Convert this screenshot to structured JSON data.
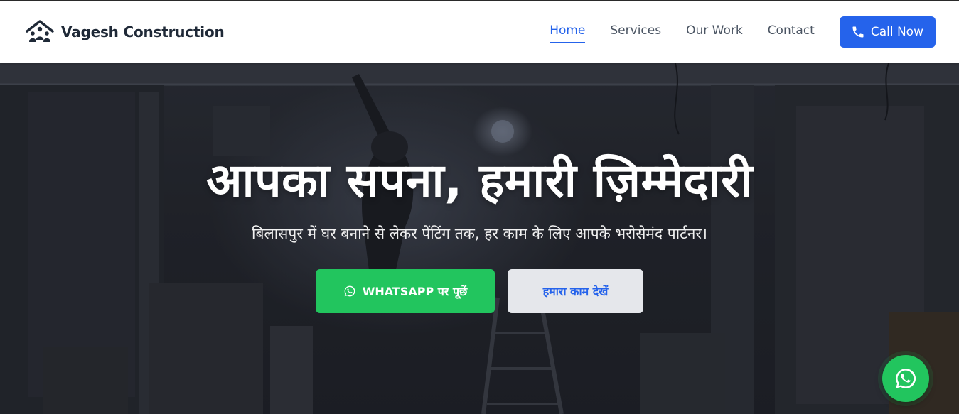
{
  "brand": {
    "name": "Vagesh Construction",
    "logo_icon": "house-with-family-icon"
  },
  "nav": {
    "links": [
      {
        "label": "Home",
        "active": true
      },
      {
        "label": "Services",
        "active": false
      },
      {
        "label": "Our Work",
        "active": false
      },
      {
        "label": "Contact",
        "active": false
      }
    ],
    "call_button": {
      "label": "Call Now",
      "icon": "phone-icon"
    }
  },
  "hero": {
    "title": "आपका सपना, हमारी ज़िम्मेदारी",
    "subtitle": "बिलासपुर में घर बनाने से लेकर पेंटिंग तक, हर काम के लिए आपके भरोसेमंद पार्टनर।",
    "whatsapp_button": {
      "label": "WHATSAPP पर पूछें",
      "icon": "whatsapp-icon"
    },
    "work_button": {
      "label": "हमारा काम देखें"
    }
  },
  "floating_whatsapp": {
    "icon": "whatsapp-icon"
  },
  "colors": {
    "primary": "#2563eb",
    "whatsapp_green": "#22c55e",
    "nav_text": "#4b5563",
    "brand_text": "#1f2937",
    "hero_bg": "#23262c"
  }
}
